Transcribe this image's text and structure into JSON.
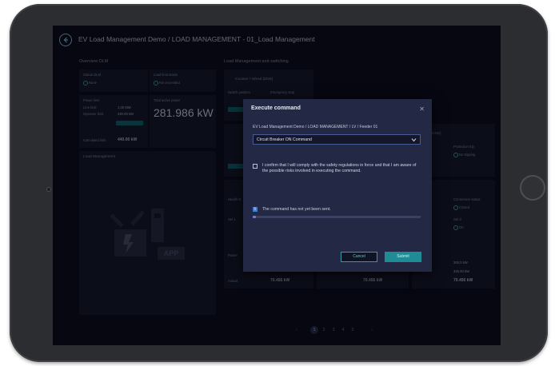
{
  "header": {
    "title": "EV Load Management Demo / LOAD MANAGEMENT - 01_Load Management"
  },
  "sections": {
    "overview": "Overview OLM",
    "switching": "Load Management and switching"
  },
  "overview": {
    "status_label": "Status OLM",
    "status_value": "None",
    "load_limit_status_label": "Load limit status",
    "load_limit_status_value": "Not exceeded",
    "power_limit_label": "Power limit",
    "line_limit_label": "Line limit",
    "line_limit_value": "1.00 MW",
    "operator_limit_label": "Operator limit",
    "operator_limit_value": "440.00 kW",
    "calculated_limit_label": "Calculated limit",
    "calculated_limit_value": "440.00 kW",
    "total_active_power_label": "Total active power",
    "total_active_power_value": "281.986 kW",
    "load_management_label": "Load Management",
    "app_label": "APP"
  },
  "switching_cards": {
    "incomer_title": "Incomer / Infeed (DNS)",
    "switch_position": "Switch position",
    "emergency_stop": "Emergency stop",
    "feeder3_title": "der 3 (DNS)",
    "ation": "ation",
    "protection_trip": "Protection trip",
    "no_tripping": "No tripping",
    "charger2_title": "arger 2",
    "connection_status": "Connection status",
    "closed": "Closed",
    "set2": "Set 2",
    "ok": "OK",
    "health_short": "Health st",
    "set1": "Set 1",
    "power_label": "Power",
    "actual_label": "Actual",
    "limit_label": "Limit",
    "reserve_label": "Reserve",
    "actual_value_1": "70.456 kW",
    "actual_value_2": "70.456 kW",
    "actual_value_3": "70.456 kW",
    "limit_value": "325.00 kW",
    "reserve_value": "300.0 kW"
  },
  "modal": {
    "title": "Execute command",
    "path": "EV Load Management Demo / LOAD MANAGEMENT / LV / Feeder 01",
    "selected_command": "Circuit Breaker ON Command",
    "confirmation": "I confirm that I will comply with the safety regulations in force and that I am aware of the possible risks involved in executing the command.",
    "status": "The command has not yet been sent.",
    "progress_fraction": 0.02,
    "cancel": "Cancel",
    "submit": "Submit"
  },
  "pagination": {
    "prev": "‹",
    "pages": [
      "1",
      "2",
      "3",
      "4",
      "5"
    ],
    "active_page": "1",
    "next": "›"
  },
  "colors": {
    "accent": "#1f8b95",
    "background": "#0c0e1c",
    "modal": "#232844",
    "bezel": "#2b2d30"
  },
  "icons": [
    "back-arrow-icon",
    "close-icon",
    "chevron-down-icon",
    "info-icon",
    "status-ok-icon",
    "plug-lightning-icon"
  ]
}
